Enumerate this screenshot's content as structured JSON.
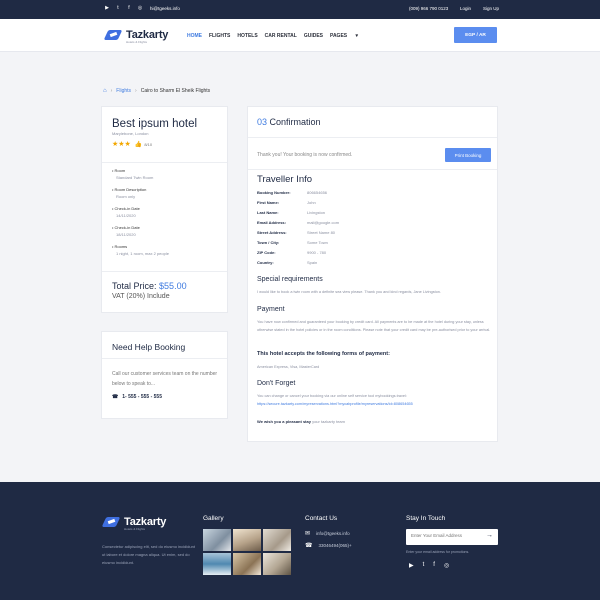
{
  "topbar": {
    "social": [
      "YT",
      "t",
      "f",
      "ig"
    ],
    "email": "hi@tgeeks.info",
    "phone": "(009) 966 790 0123",
    "login": "Login",
    "signup": "Sign Up"
  },
  "header": {
    "logo": "Tazkarty",
    "logo_sub": "Hotels & Flights",
    "nav": [
      "HOME",
      "FLIGHTS",
      "HOTELS",
      "CAR RENTAL",
      "GUIDES",
      "PAGES"
    ],
    "lang_button": "EGP / AR"
  },
  "breadcrumb": {
    "link": "Flights",
    "current": "Cairo to Sharm El Sheik Flights"
  },
  "hotel": {
    "name": "Best ipsum hotel",
    "location": "Marylebone, London",
    "stars": "★★★",
    "rating": "8/10",
    "room_label": "Room",
    "room_value": "Standard Twin Room",
    "desc_label": "Room Description",
    "desc_value": "Room only",
    "checkin_label": "Check-in Date",
    "checkin_value": "14/11/2020",
    "checkout_label": "Check-in Date",
    "checkout_value": "18/11/2020",
    "rooms_label": "Rooms",
    "rooms_value": "1 night, 1 room, max 2 people",
    "total_label": "Total Price:",
    "total_value": "$55.00",
    "vat": "VAT (20%) Include"
  },
  "help": {
    "title": "Need Help Booking",
    "text": "Call our customer services team on the number below to speak to...",
    "phone": "1- 555 - 555 - 555"
  },
  "confirmation": {
    "step": "03",
    "title": "Confirmation",
    "thanks": "Thank you! Your booking is now confirmed.",
    "print_button": "Print Booking",
    "traveller_title": "Traveller Info",
    "info": [
      {
        "k": "Booking Number:",
        "v": "806654656"
      },
      {
        "k": "First Name:",
        "v": "John"
      },
      {
        "k": "Last Name:",
        "v": "Livingston"
      },
      {
        "k": "Email Address:",
        "v": "mail@google.com"
      },
      {
        "k": "Street Address:",
        "v": "Street Name 80"
      },
      {
        "k": "Town / City:",
        "v": "Some Town"
      },
      {
        "k": "ZIP Code:",
        "v": "9900 - 780"
      },
      {
        "k": "Country:",
        "v": "Spain"
      }
    ],
    "special_title": "Special requirements",
    "special_text": "I would like to book a twin room with a definite sea view please. Thank you and kind regards, Jane Livingston.",
    "payment_title": "Payment",
    "payment_text": "You have now confirmed and guaranteed your booking by credit card. All payments are to be made at the hotel during your stay, unless otherwise stated in the hotel policies or in the room conditions. Please note that your credit card may be pre-authorised prior to your arrival.",
    "forms_title": "This hotel accepts the following forms of payment:",
    "forms_text": "American Express, Visa, MasterCard",
    "forget_title": "Don't Forget",
    "forget_text": "You can change or cancel your booking via our online self service tool mybookings.travel:",
    "forget_link": "https://secure.tazkarty.com/myreservations.html?mycabprofile/myreservations/id=808654655",
    "wish_bold": "We wish you a pleasant stay",
    "wish_rest": "your tazkarty team"
  },
  "footer": {
    "logo": "Tazkarty",
    "logo_sub": "Hotels & Flights",
    "desc": "Consectetur adipiscing elit, sed do eiusmo incididunt ut labore et dolore magna aliqua. Ut enim, sed do eiusmo incididunt.",
    "gallery_title": "Gallery",
    "contact_title": "Contact Us",
    "contact_email": "info@tgeeks.info",
    "contact_phone": "33046494(065)+",
    "stay_title": "Stay In Touch",
    "email_placeholder": "Enter Your Email Address",
    "news_note": "Enter your email address for promotions."
  }
}
